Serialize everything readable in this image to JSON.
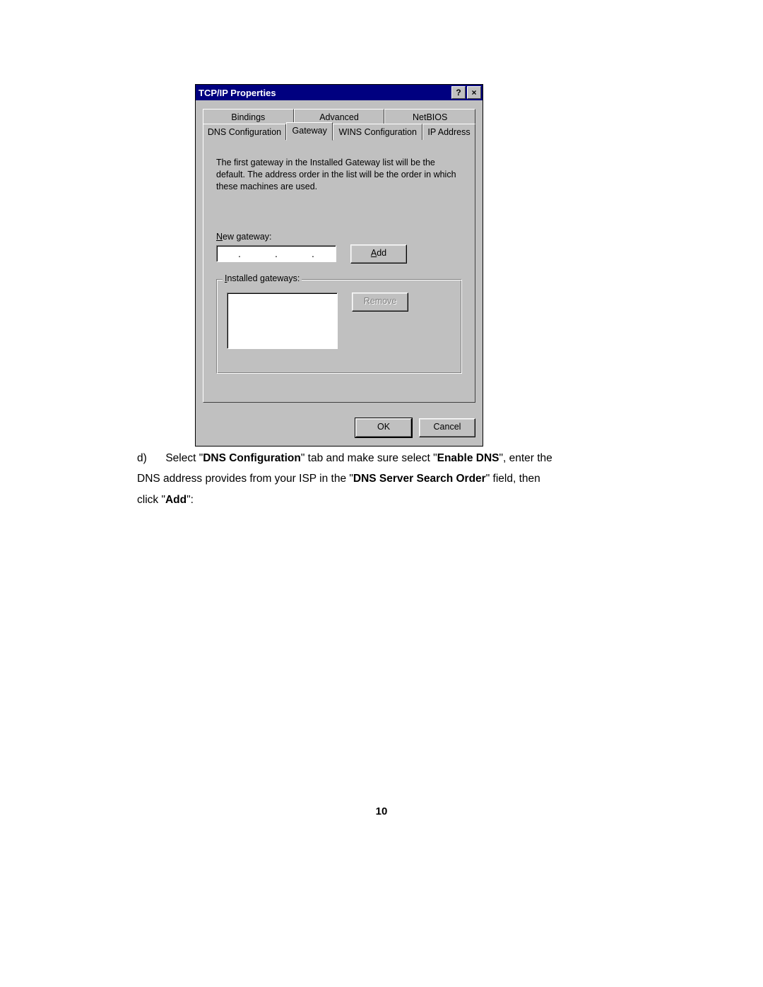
{
  "dialog": {
    "title": "TCP/IP Properties",
    "help_btn": "?",
    "close_btn": "×",
    "tabs_back": [
      "Bindings",
      "Advanced",
      "NetBIOS"
    ],
    "tabs_front": [
      "DNS Configuration",
      "Gateway",
      "WINS Configuration",
      "IP Address"
    ],
    "active_tab": "Gateway",
    "description": "The first gateway in the Installed Gateway list will be the default. The address order in the list will be the order in which these machines are used.",
    "new_gateway_label": "New gateway:",
    "add_button": "Add",
    "installed_label": "Installed gateways:",
    "remove_button": "Remove",
    "ok_button": "OK",
    "cancel_button": "Cancel"
  },
  "doc": {
    "list_marker": "d)",
    "t1": "Select \"",
    "b1": "DNS Configuration",
    "t2": "\" tab and make sure select \"",
    "b2": "Enable DNS",
    "t3": "\", enter the DNS address provides from your ISP in the \"",
    "b3": "DNS Server Search Order",
    "t4": "\" field, then click \"",
    "b4": "Add",
    "t5": "\":"
  },
  "page_number": "10"
}
